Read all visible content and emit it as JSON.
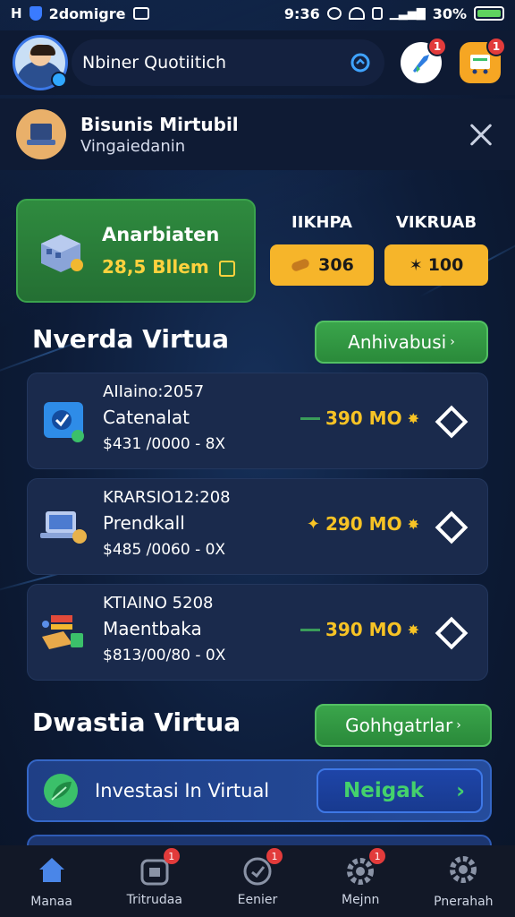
{
  "status_bar": {
    "left_text": "2domigre",
    "time": "9:36",
    "right_text": "30%"
  },
  "header": {
    "search_text": "Nbiner Quotiitich",
    "btn_one_badge": "1",
    "btn_two_badge": "1"
  },
  "banner": {
    "title": "Bisunis Mirtubil",
    "subtitle": "Vingaiedanin"
  },
  "balance": {
    "title": "Anarbiaten",
    "amount": "28,5 Bllem"
  },
  "stats": [
    {
      "label": "IIKHPA",
      "value": "306"
    },
    {
      "label": "VIKRUAB",
      "value": "100"
    }
  ],
  "section1": {
    "title": "Nverda Virtua",
    "button": "Anhivabusi"
  },
  "list": [
    {
      "code": "AIIaino:2057",
      "name": "Catenalat",
      "price": "$431 /0000 - 8X",
      "value": "390 MO"
    },
    {
      "code": "KRARSIO12:208",
      "name": "Prendkall",
      "price": "$485 /0060 - 0X",
      "value": "290 MO"
    },
    {
      "code": "KTIAINO 5208",
      "name": "Maentbaka",
      "price": "$813/00/80 - 0X",
      "value": "390 MO"
    }
  ],
  "section2": {
    "title": "Dwastia Virtua",
    "button": "Gohhgatrlar"
  },
  "invest": {
    "label": "Investasi In Virtual",
    "button": "Neigak"
  },
  "nav": [
    {
      "label": "Manaa",
      "icon": "home-icon",
      "badge": ""
    },
    {
      "label": "Tritrudaa",
      "icon": "wallet-icon",
      "badge": "1"
    },
    {
      "label": "Eenier",
      "icon": "check-circle-icon",
      "badge": "1"
    },
    {
      "label": "Mejnn",
      "icon": "gear-icon",
      "badge": "1"
    },
    {
      "label": "Pnerahah",
      "icon": "settings-icon",
      "badge": ""
    }
  ],
  "colors": {
    "accent_green": "#2f8b3f",
    "accent_gold": "#f6b52a",
    "value_yellow": "#f7c325",
    "background": "#0d1c38"
  }
}
